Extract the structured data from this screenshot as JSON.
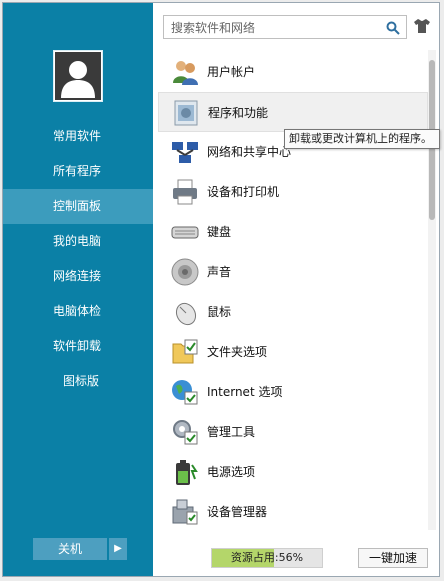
{
  "sidebar": {
    "menu": [
      {
        "label": "常用软件"
      },
      {
        "label": "所有程序"
      },
      {
        "label": "控制面板"
      },
      {
        "label": "我的电脑"
      },
      {
        "label": "网络连接"
      },
      {
        "label": "电脑体检"
      },
      {
        "label": "软件卸载"
      },
      {
        "label": "图标版"
      }
    ],
    "active_index": 2,
    "shutdown_label": "关机",
    "shutdown_arrow": "▶"
  },
  "search": {
    "placeholder": "搜索软件和网络",
    "value": ""
  },
  "items": [
    {
      "label": "用户帐户",
      "icon": "users-icon"
    },
    {
      "label": "程序和功能",
      "icon": "programs-features-icon"
    },
    {
      "label": "网络和共享中心",
      "icon": "network-sharing-icon"
    },
    {
      "label": "设备和打印机",
      "icon": "printer-icon"
    },
    {
      "label": "键盘",
      "icon": "keyboard-icon"
    },
    {
      "label": "声音",
      "icon": "speaker-icon"
    },
    {
      "label": "鼠标",
      "icon": "mouse-icon"
    },
    {
      "label": "文件夹选项",
      "icon": "folder-options-icon"
    },
    {
      "label": "Internet 选项",
      "icon": "internet-options-icon"
    },
    {
      "label": "管理工具",
      "icon": "admin-tools-icon"
    },
    {
      "label": "电源选项",
      "icon": "power-options-icon"
    },
    {
      "label": "设备管理器",
      "icon": "device-manager-icon"
    }
  ],
  "tooltip": "卸载或更改计算机上的程序。",
  "footer": {
    "usage_label": "资源占用:56%",
    "usage_percent": 56,
    "boost_label": "一键加速"
  },
  "colors": {
    "sidebar": "#0b80a6",
    "active": "#3c9cbd",
    "usage_fill": "#b4d66a"
  }
}
